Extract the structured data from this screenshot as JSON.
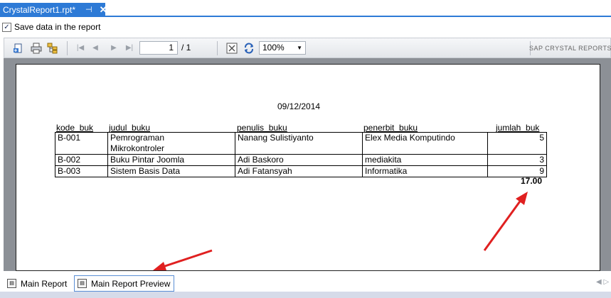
{
  "document_tab": {
    "title": "CrystalReport1.rpt*",
    "pin_glyph": "⊣",
    "close_glyph": "✕"
  },
  "save_data": {
    "label": "Save data in the report",
    "checked": true
  },
  "toolbar": {
    "page_current": "1",
    "page_total": "/ 1",
    "zoom_value": "100%",
    "brand": "SAP CRYSTAL REPORTS"
  },
  "report": {
    "date": "09/12/2014",
    "columns": [
      "kode_buk",
      "judul_buku",
      "penulis_buku",
      "penerbit_buku",
      "jumlah_buk"
    ],
    "rows": [
      {
        "kode": "B-001",
        "judul_line1": "Pemrograman",
        "judul_line2": "Mikrokontroler",
        "penulis": "Nanang Sulistiyanto",
        "penerbit": "Elex Media Komputindo",
        "jumlah": "5"
      },
      {
        "kode": "B-002",
        "judul_line1": "Buku Pintar Joomla",
        "judul_line2": "",
        "penulis": "Adi Baskoro",
        "penerbit": "mediakita",
        "jumlah": "3"
      },
      {
        "kode": "B-003",
        "judul_line1": "Sistem Basis Data",
        "judul_line2": "",
        "penulis": "Adi Fatansyah",
        "penerbit": "Informatika",
        "jumlah": "9"
      }
    ],
    "total": "17.00"
  },
  "bottom_tabs": [
    {
      "label": "Main Report"
    },
    {
      "label": "Main Report Preview"
    }
  ],
  "colors": {
    "accent": "#2d7ad6",
    "annotation": "#e02020",
    "canvas": "#8c9096"
  }
}
